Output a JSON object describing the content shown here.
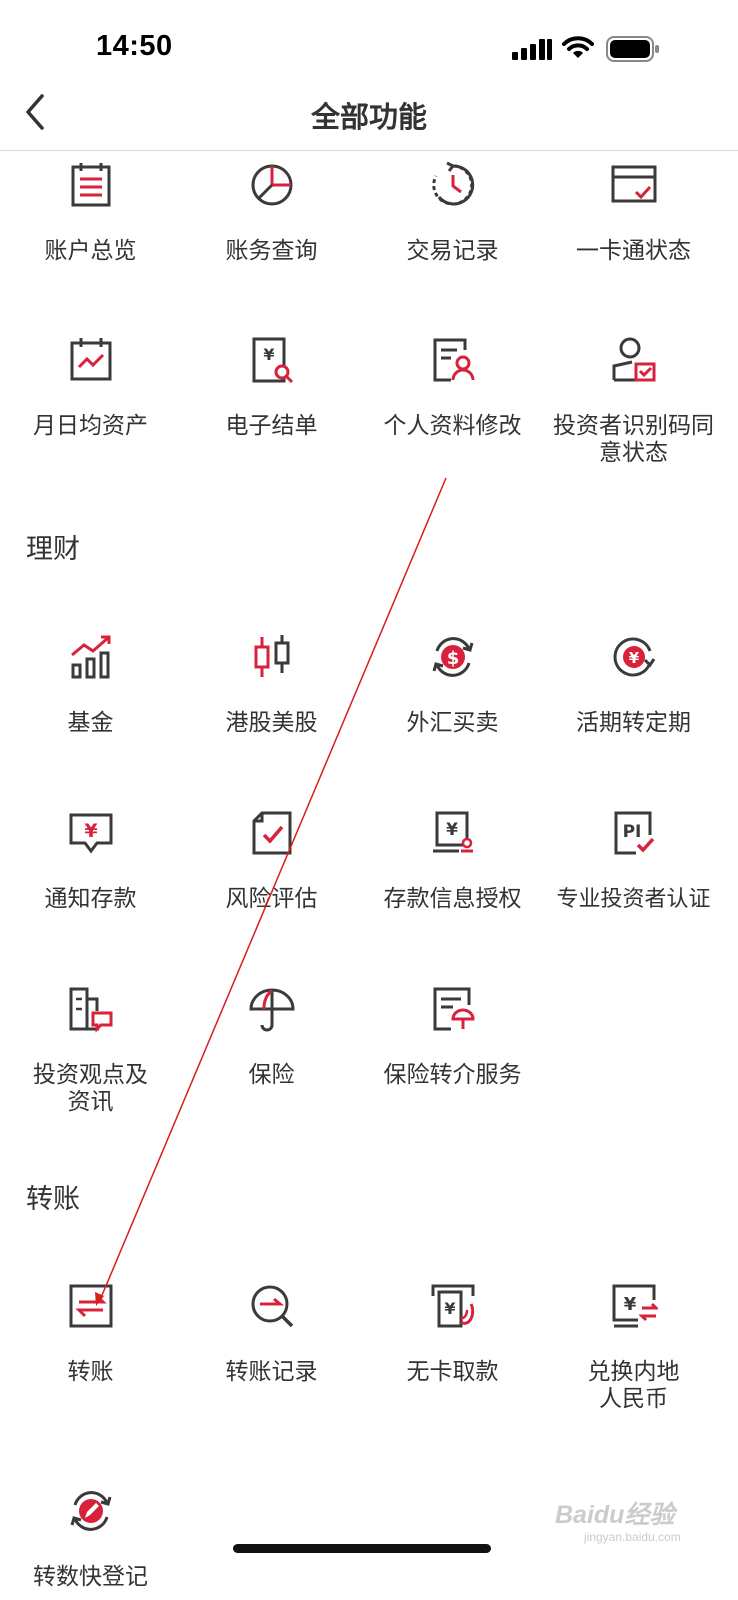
{
  "status_bar": {
    "time": "14:50"
  },
  "header": {
    "title": "全部功能"
  },
  "sections": [
    {
      "title": "",
      "items": [
        {
          "label": "账户总览",
          "icon": "clipboard-list-icon"
        },
        {
          "label": "账务查询",
          "icon": "pie-chart-icon"
        },
        {
          "label": "交易记录",
          "icon": "clock-history-icon"
        },
        {
          "label": "一卡通状态",
          "icon": "card-check-icon"
        },
        {
          "label": "月日均资产",
          "icon": "calendar-chart-icon"
        },
        {
          "label": "电子结单",
          "icon": "yen-statement-search-icon"
        },
        {
          "label": "个人资料修改",
          "icon": "profile-edit-icon"
        },
        {
          "label": "投资者识别码同意状态",
          "icon": "user-check-icon"
        }
      ]
    },
    {
      "title": "理财",
      "items": [
        {
          "label": "基金",
          "icon": "fund-chart-icon"
        },
        {
          "label": "港股美股",
          "icon": "candlestick-icon"
        },
        {
          "label": "外汇买卖",
          "icon": "dollar-exchange-icon"
        },
        {
          "label": "活期转定期",
          "icon": "yen-cycle-icon"
        },
        {
          "label": "通知存款",
          "icon": "yen-message-icon"
        },
        {
          "label": "风险评估",
          "icon": "document-check-icon"
        },
        {
          "label": "存款信息授权",
          "icon": "yen-authorize-icon"
        },
        {
          "label": "专业投资者认证",
          "icon": "pi-check-icon"
        },
        {
          "label": "投资观点及资讯",
          "icon": "building-message-icon"
        },
        {
          "label": "保险",
          "icon": "umbrella-icon"
        },
        {
          "label": "保险转介服务",
          "icon": "document-umbrella-icon"
        }
      ]
    },
    {
      "title": "转账",
      "items": [
        {
          "label": "转账",
          "icon": "transfer-icon"
        },
        {
          "label": "转账记录",
          "icon": "transfer-search-icon"
        },
        {
          "label": "无卡取款",
          "icon": "cardless-withdraw-icon"
        },
        {
          "label": "兑换内地人民币",
          "icon": "yen-exchange-icon"
        },
        {
          "label": "转数快登记",
          "icon": "fps-register-icon"
        }
      ]
    }
  ],
  "colors": {
    "accent": "#d8213b",
    "icon_gray": "#3a3a3a",
    "arrow": "#d81e1e"
  },
  "watermark": {
    "text": "Baidu经验",
    "sub": "jingyan.baidu.com"
  }
}
